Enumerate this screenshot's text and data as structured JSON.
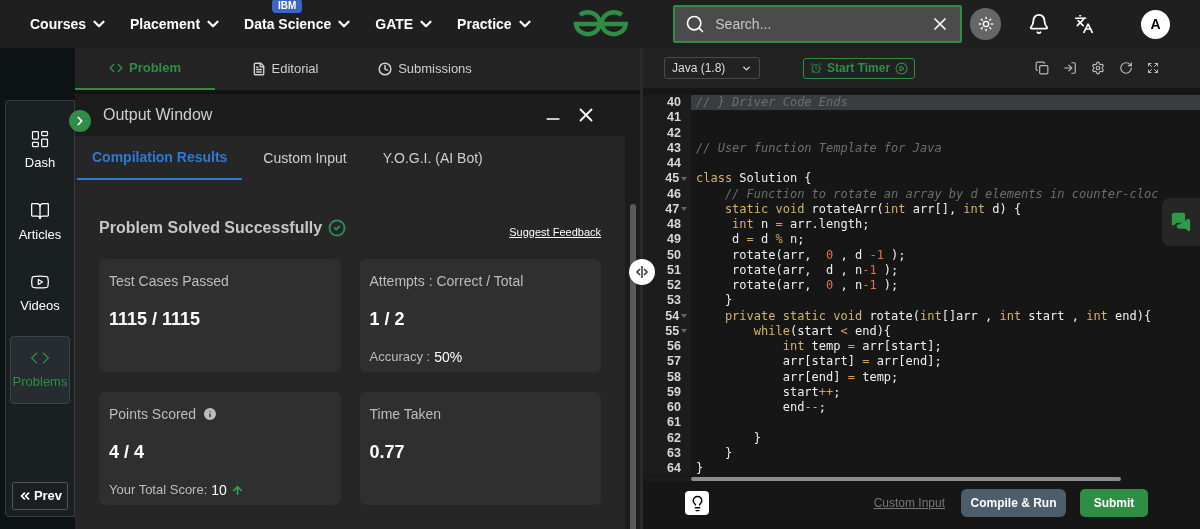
{
  "nav": {
    "items": [
      {
        "label": "Courses"
      },
      {
        "label": "Placement"
      },
      {
        "label": "Data Science",
        "badge": "IBM"
      },
      {
        "label": "GATE"
      },
      {
        "label": "Practice"
      }
    ],
    "search": {
      "placeholder": "Search..."
    },
    "avatar": "A"
  },
  "problem_tabs": [
    {
      "label": "Problem",
      "selected": true
    },
    {
      "label": "Editorial",
      "selected": false
    },
    {
      "label": "Submissions",
      "selected": false
    }
  ],
  "sidebar": {
    "items": [
      {
        "label": "Dash",
        "selected": false
      },
      {
        "label": "Articles",
        "selected": false
      },
      {
        "label": "Videos",
        "selected": false
      },
      {
        "label": "Problems",
        "selected": true
      }
    ],
    "prev_button": "Prev"
  },
  "output_window": {
    "title": "Output Window",
    "tabs": [
      {
        "label": "Compilation Results",
        "selected": true
      },
      {
        "label": "Custom Input",
        "selected": false
      },
      {
        "label": "Y.O.G.I. (AI Bot)",
        "selected": false
      }
    ],
    "status": "Problem Solved Successfully",
    "feedback_link": "Suggest Feedback",
    "cards": [
      {
        "title": "Test Cases Passed",
        "value": "1115 / 1115",
        "info_icon": false,
        "trend_up": false
      },
      {
        "title": "Attempts : Correct / Total",
        "value": "1 / 2",
        "footer_label": "Accuracy :",
        "footer_value": "50%",
        "info_icon": false,
        "trend_up": false
      },
      {
        "title": "Points Scored",
        "value": "4 / 4",
        "footer_label": "Your Total Score:",
        "footer_value": "10",
        "info_icon": true,
        "trend_up": true
      },
      {
        "title": "Time Taken",
        "value": "0.77",
        "info_icon": false,
        "trend_up": false
      }
    ]
  },
  "editor": {
    "language": "Java (1.8)",
    "timer_button": "Start Timer",
    "lines": [
      {
        "number": "40",
        "selected": true,
        "fold": false,
        "tokens": [
          {
            "kind": "comment",
            "text": "// } Driver Code Ends"
          }
        ]
      },
      {
        "number": "41",
        "selected": false,
        "fold": false
      },
      {
        "number": "42",
        "selected": false,
        "fold": false
      },
      {
        "number": "43",
        "selected": false,
        "fold": false,
        "tokens": [
          {
            "kind": "comment",
            "text": "// User function Template for Java"
          }
        ]
      },
      {
        "number": "44",
        "selected": false,
        "fold": false
      },
      {
        "number": "45",
        "selected": false,
        "fold": true,
        "tokens": [
          {
            "kind": "keyword",
            "text": "class"
          },
          {
            "kind": "plain",
            "text": " Solution {"
          }
        ]
      },
      {
        "number": "46",
        "selected": false,
        "fold": false,
        "tokens": [
          {
            "kind": "comment",
            "text": "    // Function to rotate an array by d elements in counter-cloc"
          }
        ]
      },
      {
        "number": "47",
        "selected": false,
        "fold": true,
        "tokens": [
          {
            "kind": "keyword",
            "text": "    static void"
          },
          {
            "kind": "plain",
            "text": " rotateArr("
          },
          {
            "kind": "keyword",
            "text": "int"
          },
          {
            "kind": "plain",
            "text": " arr[], "
          },
          {
            "kind": "keyword",
            "text": "int"
          },
          {
            "kind": "plain",
            "text": " d) {"
          }
        ]
      },
      {
        "number": "48",
        "selected": false,
        "fold": false,
        "tokens": [
          {
            "kind": "keyword",
            "text": "     int"
          },
          {
            "kind": "plain",
            "text": " n "
          },
          {
            "kind": "operator",
            "text": "="
          },
          {
            "kind": "plain",
            "text": " arr.length;"
          }
        ]
      },
      {
        "number": "49",
        "selected": false,
        "fold": false,
        "tokens": [
          {
            "kind": "plain",
            "text": "     d "
          },
          {
            "kind": "operator",
            "text": "="
          },
          {
            "kind": "plain",
            "text": " d "
          },
          {
            "kind": "operator",
            "text": "%"
          },
          {
            "kind": "plain",
            "text": " n;"
          }
        ]
      },
      {
        "number": "50",
        "selected": false,
        "fold": false,
        "tokens": [
          {
            "kind": "plain",
            "text": "     rotate(arr,  "
          },
          {
            "kind": "number",
            "text": "0"
          },
          {
            "kind": "plain",
            "text": " , d "
          },
          {
            "kind": "number",
            "text": "-1"
          },
          {
            "kind": "plain",
            "text": " );"
          }
        ]
      },
      {
        "number": "51",
        "selected": false,
        "fold": false,
        "tokens": [
          {
            "kind": "plain",
            "text": "     rotate(arr,  d , n"
          },
          {
            "kind": "number",
            "text": "-1"
          },
          {
            "kind": "plain",
            "text": " );"
          }
        ]
      },
      {
        "number": "52",
        "selected": false,
        "fold": false,
        "tokens": [
          {
            "kind": "plain",
            "text": "     rotate(arr,  "
          },
          {
            "kind": "number",
            "text": "0"
          },
          {
            "kind": "plain",
            "text": " , n"
          },
          {
            "kind": "number",
            "text": "-1"
          },
          {
            "kind": "plain",
            "text": " );"
          }
        ]
      },
      {
        "number": "53",
        "selected": false,
        "fold": false,
        "tokens": [
          {
            "kind": "plain",
            "text": "    }"
          }
        ]
      },
      {
        "number": "54",
        "selected": false,
        "fold": true,
        "tokens": [
          {
            "kind": "keyword",
            "text": "    private static void"
          },
          {
            "kind": "plain",
            "text": " rotate("
          },
          {
            "kind": "keyword",
            "text": "int"
          },
          {
            "kind": "plain",
            "text": "[]arr , "
          },
          {
            "kind": "keyword",
            "text": "int"
          },
          {
            "kind": "plain",
            "text": " start , "
          },
          {
            "kind": "keyword",
            "text": "int"
          },
          {
            "kind": "plain",
            "text": " end){"
          }
        ]
      },
      {
        "number": "55",
        "selected": false,
        "fold": true,
        "tokens": [
          {
            "kind": "keyword",
            "text": "        while"
          },
          {
            "kind": "plain",
            "text": "(start "
          },
          {
            "kind": "operator",
            "text": "<"
          },
          {
            "kind": "plain",
            "text": " end){"
          }
        ]
      },
      {
        "number": "56",
        "selected": false,
        "fold": false,
        "tokens": [
          {
            "kind": "keyword",
            "text": "            int"
          },
          {
            "kind": "plain",
            "text": " temp "
          },
          {
            "kind": "operator",
            "text": "="
          },
          {
            "kind": "plain",
            "text": " arr[start];"
          }
        ]
      },
      {
        "number": "57",
        "selected": false,
        "fold": false,
        "tokens": [
          {
            "kind": "plain",
            "text": "            arr[start] "
          },
          {
            "kind": "operator",
            "text": "="
          },
          {
            "kind": "plain",
            "text": " arr[end];"
          }
        ]
      },
      {
        "number": "58",
        "selected": false,
        "fold": false,
        "tokens": [
          {
            "kind": "plain",
            "text": "            arr[end] "
          },
          {
            "kind": "operator",
            "text": "="
          },
          {
            "kind": "plain",
            "text": " temp;"
          }
        ]
      },
      {
        "number": "59",
        "selected": false,
        "fold": false,
        "tokens": [
          {
            "kind": "plain",
            "text": "            start"
          },
          {
            "kind": "operator",
            "text": "++"
          },
          {
            "kind": "plain",
            "text": ";"
          }
        ]
      },
      {
        "number": "60",
        "selected": false,
        "fold": false,
        "tokens": [
          {
            "kind": "plain",
            "text": "            end"
          },
          {
            "kind": "operator",
            "text": "--"
          },
          {
            "kind": "plain",
            "text": ";"
          }
        ]
      },
      {
        "number": "61",
        "selected": false,
        "fold": false
      },
      {
        "number": "62",
        "selected": false,
        "fold": false,
        "tokens": [
          {
            "kind": "plain",
            "text": "        }"
          }
        ]
      },
      {
        "number": "63",
        "selected": false,
        "fold": false,
        "tokens": [
          {
            "kind": "plain",
            "text": "    }"
          }
        ]
      },
      {
        "number": "64",
        "selected": false,
        "fold": false,
        "tokens": [
          {
            "kind": "plain",
            "text": "}"
          }
        ]
      }
    ],
    "custom_input": "Custom Input",
    "compile_button": "Compile & Run",
    "submit_button": "Submit"
  }
}
